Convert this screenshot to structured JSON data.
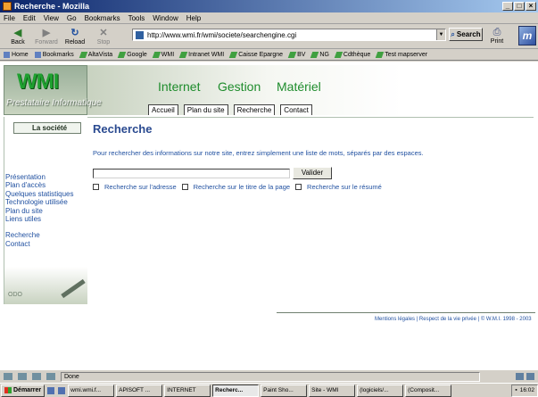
{
  "window": {
    "title": "Recherche - Mozilla",
    "controls": [
      "_",
      "□",
      "×"
    ]
  },
  "menu": [
    "File",
    "Edit",
    "View",
    "Go",
    "Bookmarks",
    "Tools",
    "Window",
    "Help"
  ],
  "nav": {
    "back": "Back",
    "forward": "Forward",
    "reload": "Reload",
    "stop": "Stop",
    "url": "http://www.wmi.fr/wmi/societe/searchengine.cgi",
    "search": "Search",
    "print": "Print",
    "logo": "m"
  },
  "personal_toolbar": [
    "Home",
    "Bookmarks",
    "AltaVista",
    "Google",
    "WMI",
    "Intranet WMI",
    "Caisse Epargne",
    "BV",
    "NG",
    "Cdthèque",
    "Test mapserver"
  ],
  "site": {
    "logo": "WMI",
    "tagline": "Prestataire Informatique",
    "sectors": [
      "Internet",
      "Gestion",
      "Matériel"
    ],
    "tabs": [
      "Accueil",
      "Plan du site",
      "Recherche",
      "Contact"
    ],
    "sidebar_tab": "La société",
    "sidebar_links": [
      "Présentation",
      "Plan d'accès",
      "Quelques statistiques",
      "Technologie utilisée",
      "Plan du site",
      "Liens utiles"
    ],
    "sidebar_links_2": [
      "Recherche",
      "Contact"
    ],
    "sidebar_deco": "ODO"
  },
  "main": {
    "title": "Recherche",
    "intro": "Pour rechercher des informations sur notre site, entrez simplement une liste de mots, séparés par des espaces.",
    "search_value": "",
    "submit": "Valider",
    "checks": [
      "Recherche sur l'adresse",
      "Recherche sur le titre de la page",
      "Recherche sur le résumé"
    ],
    "footer": "Mentions légales | Respect de la vie privée | © W.M.I. 1998 - 2003"
  },
  "status": {
    "text": "Done"
  },
  "taskbar": {
    "start": "Démarrer",
    "tasks": [
      "wmi.wmi.f...",
      "APISOFT ...",
      "INTERNET",
      "Recherc...",
      "Paint Sho...",
      "Site - WMI",
      "(logiciels/...",
      "(Composit..."
    ],
    "clock": "16:02"
  }
}
